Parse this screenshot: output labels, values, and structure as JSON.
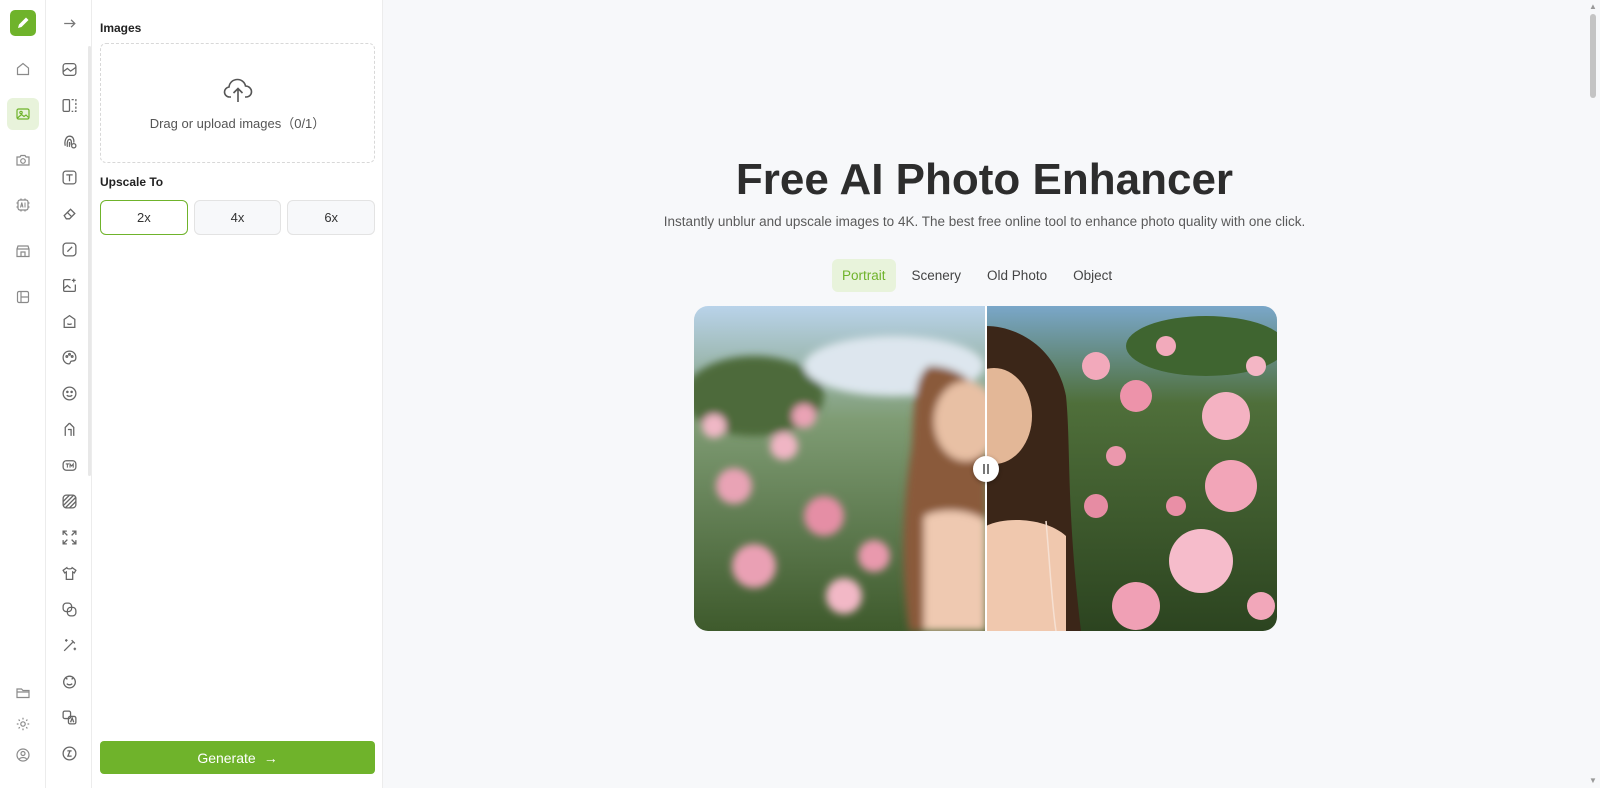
{
  "rail": {
    "items": [
      {
        "icon": "home-icon"
      },
      {
        "icon": "image-icon",
        "active": true
      },
      {
        "icon": "camera-icon"
      },
      {
        "icon": "ai-chip-icon"
      },
      {
        "icon": "store-icon"
      },
      {
        "icon": "layout-icon"
      }
    ],
    "bottom": [
      {
        "icon": "folder-icon"
      },
      {
        "icon": "gear-icon"
      },
      {
        "icon": "user-icon"
      }
    ]
  },
  "panel": {
    "images_label": "Images",
    "upload_text": "Drag or upload images（0/1）",
    "upscale_label": "Upscale To",
    "scales": [
      "2x",
      "4x",
      "6x"
    ],
    "selected_scale": "2x",
    "generate_label": "Generate",
    "generate_arrow": "→"
  },
  "main": {
    "title": "Free AI Photo Enhancer",
    "subtitle": "Instantly unblur and upscale images to 4K. The best free online tool to enhance photo quality with one click.",
    "tabs": [
      "Portrait",
      "Scenery",
      "Old Photo",
      "Object"
    ],
    "active_tab": "Portrait"
  },
  "colors": {
    "accent": "#6fb32b",
    "accent_soft": "#e8f3db"
  }
}
